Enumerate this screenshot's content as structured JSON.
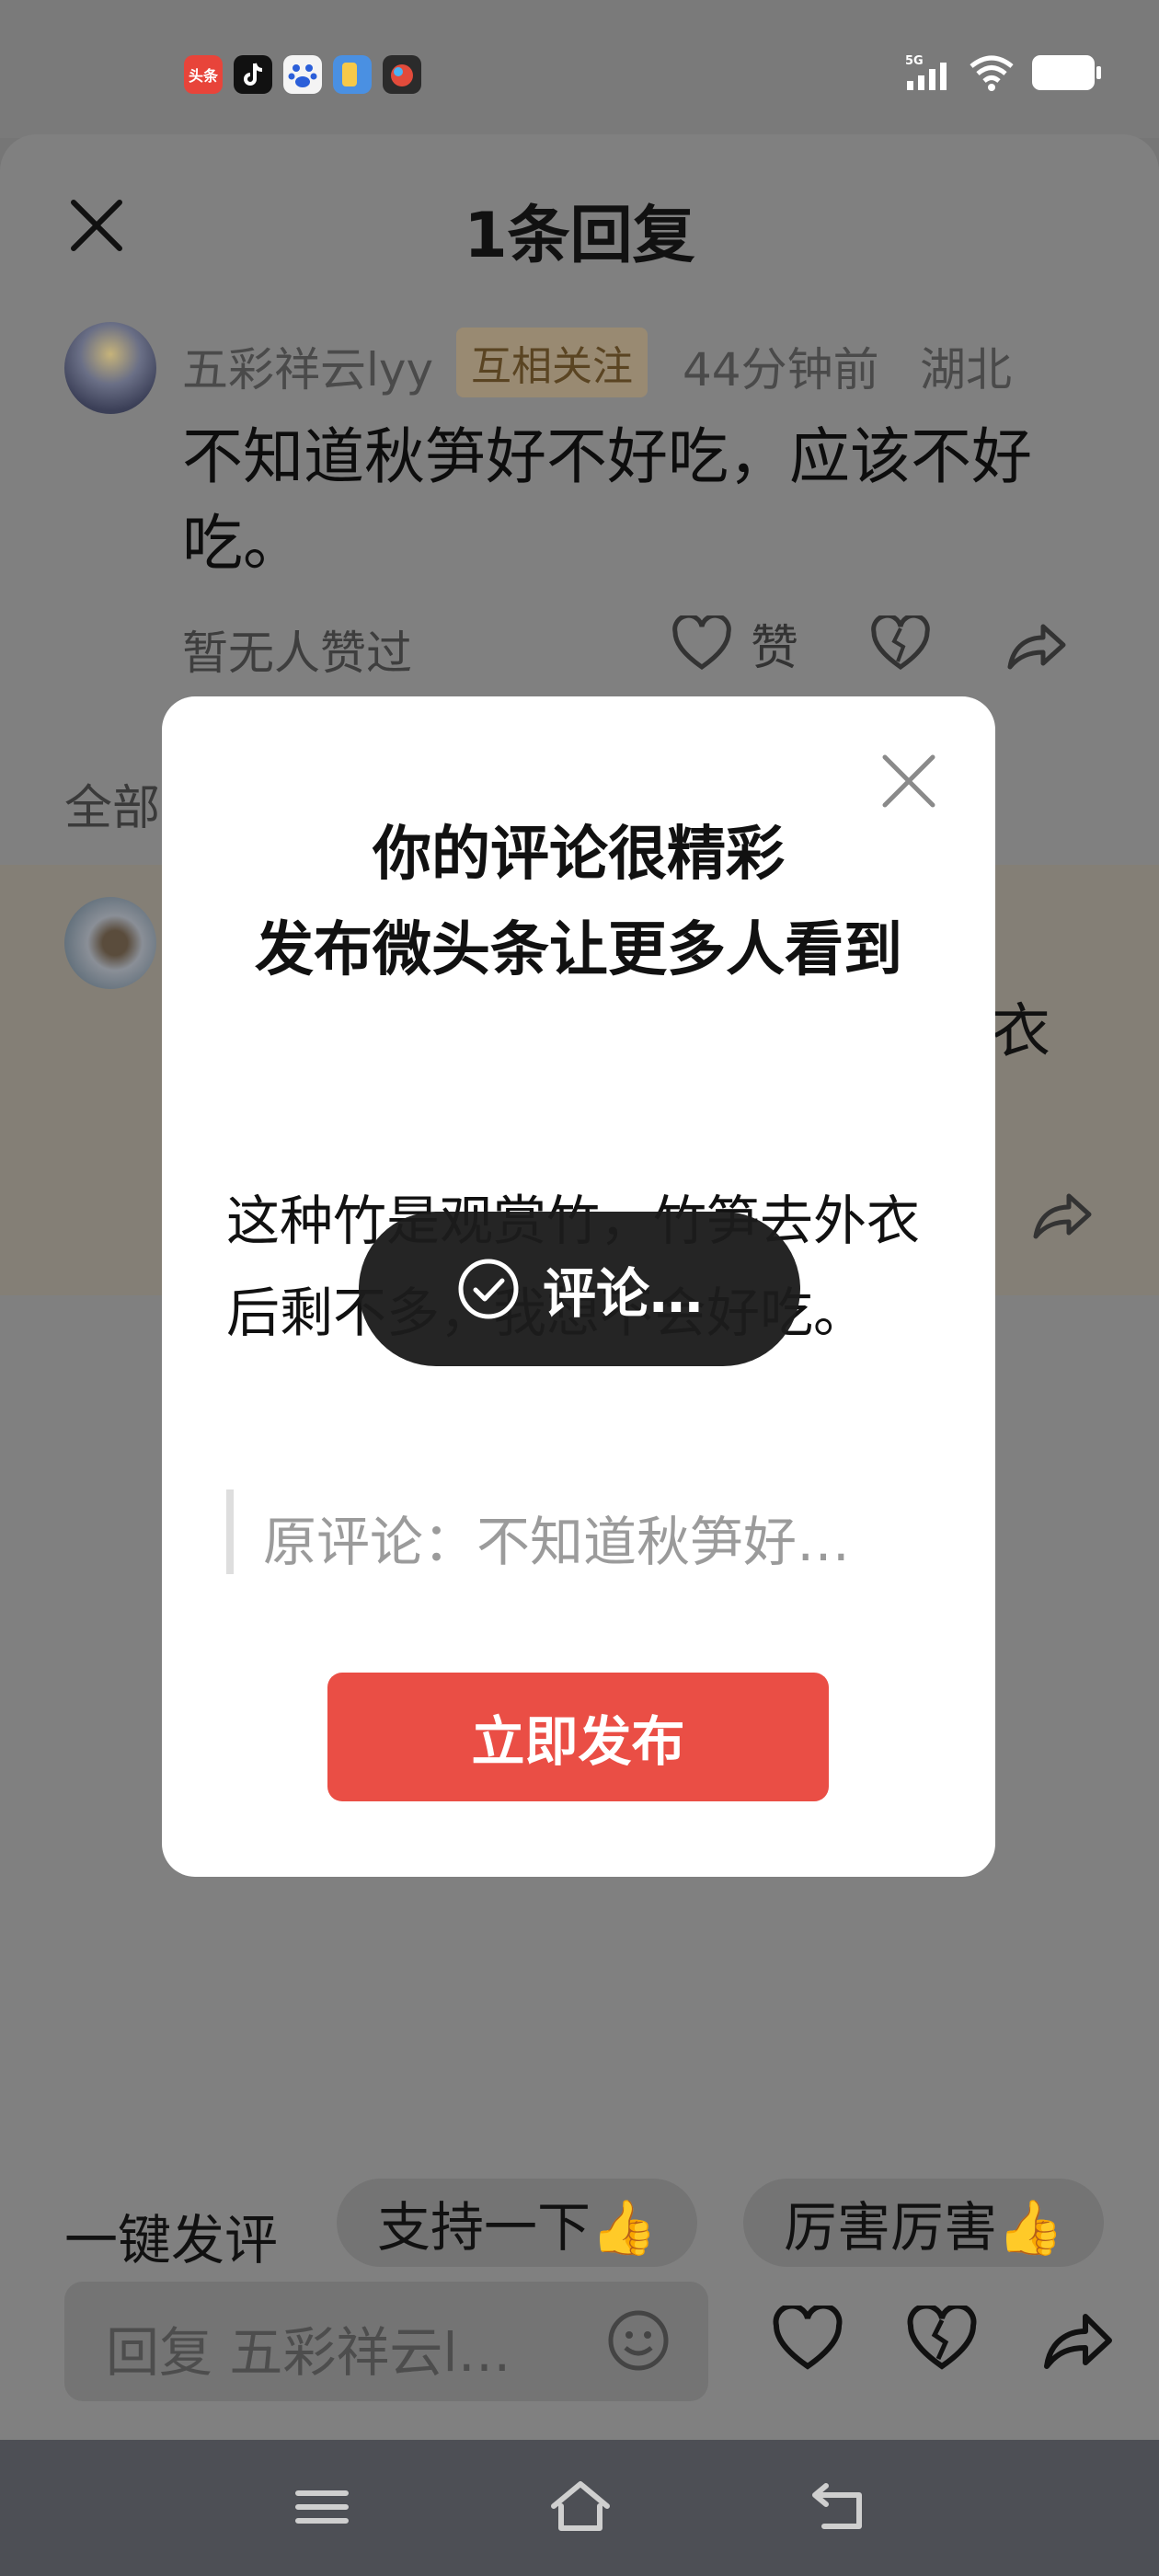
{
  "status_bar": {
    "network": "5G",
    "apps": [
      {
        "name": "toutiao-app-icon",
        "label": "头条"
      },
      {
        "name": "douyin-app-icon"
      },
      {
        "name": "baidu-app-icon"
      },
      {
        "name": "blue-app-icon"
      },
      {
        "name": "game-app-icon"
      }
    ]
  },
  "sheet": {
    "title": "1条回复"
  },
  "comment": {
    "user": "五彩祥云lyy",
    "badge": "互相关注",
    "time": "44分钟前",
    "location": "湖北",
    "text": "不知道秋笋好不好吃，应该不好吃。",
    "no_likes": "暂无人赞过",
    "like_label": "赞"
  },
  "replies_section": {
    "label": "全部",
    "reply_tail_text": "衣"
  },
  "modal": {
    "title_line1": "你的评论很精彩",
    "title_line2": "发布微头条让更多人看到",
    "body": "这种竹是观赏竹，竹笋去外衣后剩不多，我想不会好吃。",
    "quote": "原评论：不知道秋笋好…",
    "publish_label": "立即发布"
  },
  "toast": {
    "text": "评论…"
  },
  "quick_reply": {
    "label": "一键发评",
    "chips": [
      "支持一下👍",
      "厉害厉害👍"
    ]
  },
  "reply_bar": {
    "placeholder": "回复 五彩祥云l…"
  },
  "colors": {
    "accent_red": "#ea4e45",
    "overlay": "#808080",
    "badge_bg": "#998a72"
  }
}
